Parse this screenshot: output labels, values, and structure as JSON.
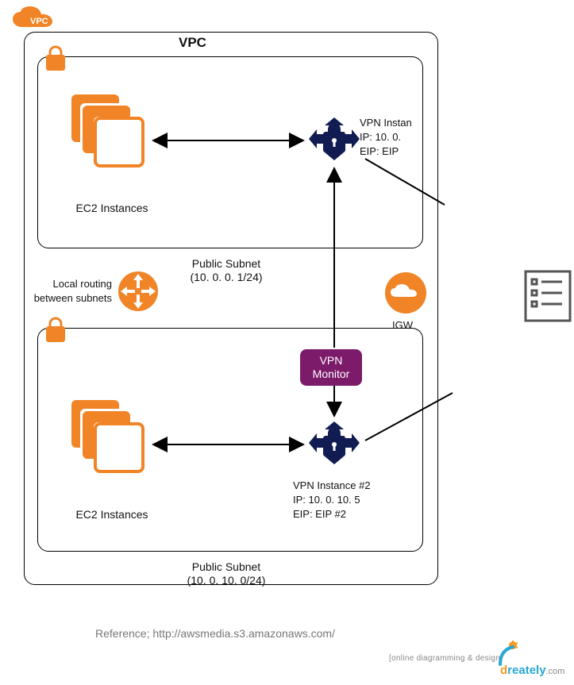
{
  "title": "VPC",
  "vpc_badge": "VPC",
  "subnet1": {
    "label": "Public Subnet",
    "cidr": "(10. 0. 0. 1/24)",
    "ec2_label": "EC2 Instances",
    "vpn_name": "VPN Instan",
    "vpn_ip": "IP: 10. 0.",
    "vpn_eip": "EIP: EIP"
  },
  "subnet2": {
    "label": "Public Subnet",
    "cidr": "(10. 0. 10. 0/24)",
    "ec2_label": "EC2 Instances",
    "vpn_name": "VPN Instance #2",
    "vpn_ip": "IP: 10. 0. 10. 5",
    "vpn_eip": "EIP: EIP #2"
  },
  "routing_label_1": "Local routing",
  "routing_label_2": "between subnets",
  "vpn_monitor_1": "VPN",
  "vpn_monitor_2": "Monitor",
  "igw_label": "IGW",
  "reference": "Reference; http://awsmedia.s3.amazonaws.com/",
  "footer_tag": "[online diagramming & design]",
  "brand_d": "d",
  "brand_rest": "reately",
  "brand_com": ".com",
  "colors": {
    "orange": "#f08426",
    "navy": "#111c52",
    "purple": "#7b1b6a",
    "brand_orange": "#f59a22",
    "brand_blue": "#2aa7d3"
  }
}
